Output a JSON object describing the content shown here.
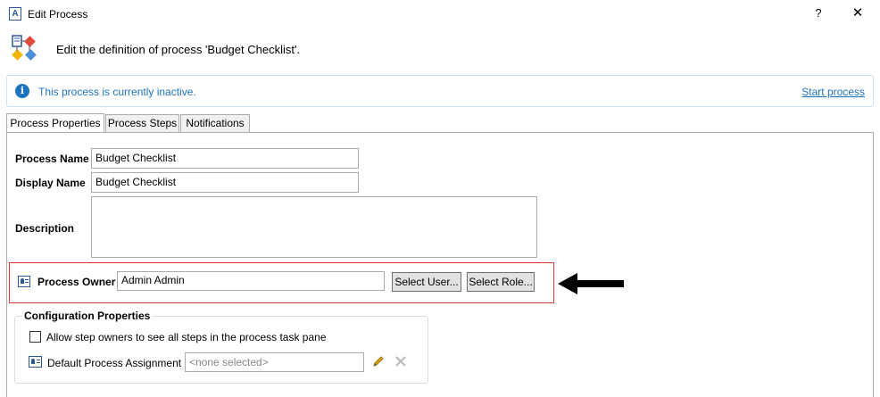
{
  "window": {
    "app_icon_letter": "A",
    "title": "Edit Process",
    "help_glyph": "?",
    "close_glyph": "✕"
  },
  "header": {
    "icon": "process-icon",
    "text": "Edit the definition of process 'Budget Checklist'."
  },
  "info_bar": {
    "icon": "info-icon",
    "message": "This process is currently inactive.",
    "action_link": "Start process"
  },
  "tabs": [
    {
      "label": "Process Properties",
      "active": true
    },
    {
      "label": "Process Steps",
      "active": false
    },
    {
      "label": "Notifications",
      "active": false
    }
  ],
  "form": {
    "process_name": {
      "label": "Process Name",
      "value": "Budget Checklist"
    },
    "display_name": {
      "label": "Display Name",
      "value": "Budget Checklist"
    },
    "description": {
      "label": "Description",
      "value": ""
    },
    "process_owner": {
      "label": "Process Owner",
      "value": "Admin Admin",
      "select_user_label": "Select User...",
      "select_role_label": "Select Role..."
    }
  },
  "configuration": {
    "title": "Configuration Properties",
    "allow_step_owners": {
      "label": "Allow step owners to see all steps in the process task pane",
      "checked": false
    },
    "default_assignment": {
      "label": "Default Process Assignment",
      "placeholder": "<none selected>"
    }
  },
  "colors": {
    "accent_blue": "#1e73be",
    "highlight_red": "#e23b3b"
  }
}
